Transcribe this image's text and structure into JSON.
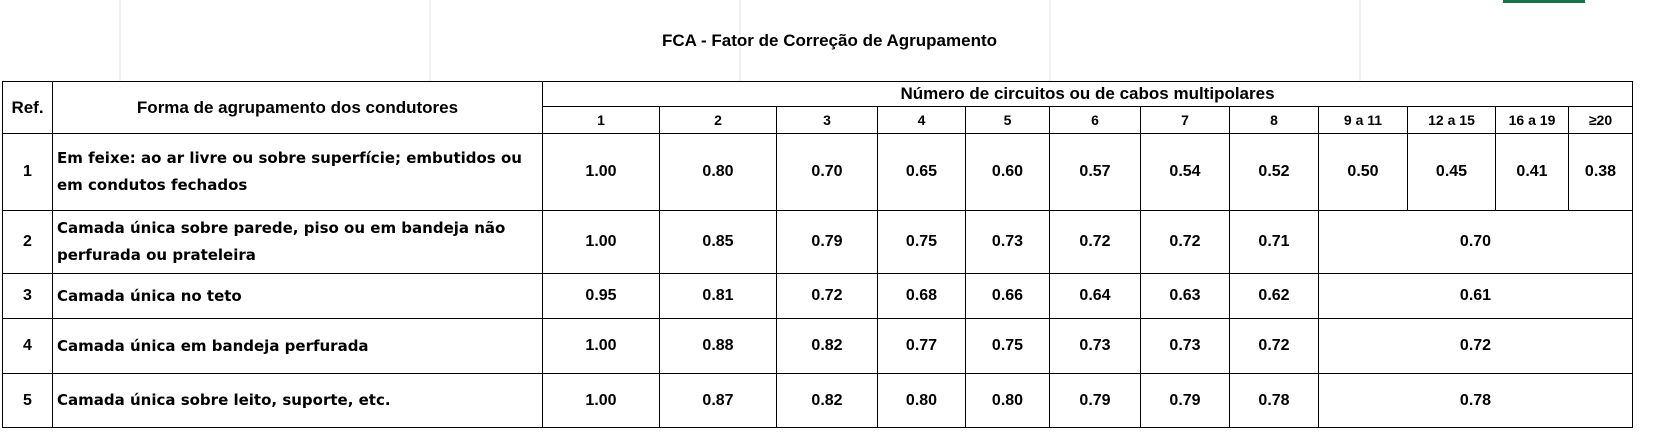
{
  "title": "FCA - Fator de Correção de Agrupamento",
  "header": {
    "ref": "Ref.",
    "forma": "Forma de agrupamento dos condutores",
    "numero": "Número de circuitos ou de cabos multipolares",
    "columns": [
      "1",
      "2",
      "3",
      "4",
      "5",
      "6",
      "7",
      "8",
      "9 a 11",
      "12 a 15",
      "16 a 19",
      "≥20"
    ]
  },
  "rows": [
    {
      "ref": "1",
      "desc": "Em feixe: ao ar livre ou sobre superfície; embutidos ou em condutos fechados",
      "values": [
        "1.00",
        "0.80",
        "0.70",
        "0.65",
        "0.60",
        "0.57",
        "0.54",
        "0.52",
        "0.50",
        "0.45",
        "0.41",
        "0.38"
      ]
    },
    {
      "ref": "2",
      "desc": "Camada única sobre parede, piso ou em bandeja não perfurada ou prateleira",
      "values": [
        "1.00",
        "0.85",
        "0.79",
        "0.75",
        "0.73",
        "0.72",
        "0.72",
        "0.71"
      ],
      "merged": "0.70"
    },
    {
      "ref": "3",
      "desc": "Camada única no teto",
      "values": [
        "0.95",
        "0.81",
        "0.72",
        "0.68",
        "0.66",
        "0.64",
        "0.63",
        "0.62"
      ],
      "merged": "0.61"
    },
    {
      "ref": "4",
      "desc": "Camada única em bandeja perfurada",
      "values": [
        "1.00",
        "0.88",
        "0.82",
        "0.77",
        "0.75",
        "0.73",
        "0.73",
        "0.72"
      ],
      "merged": "0.72"
    },
    {
      "ref": "5",
      "desc": "Camada única sobre leito, suporte, etc.",
      "values": [
        "1.00",
        "0.87",
        "0.82",
        "0.80",
        "0.80",
        "0.79",
        "0.79",
        "0.78"
      ],
      "merged": "0.78"
    }
  ]
}
